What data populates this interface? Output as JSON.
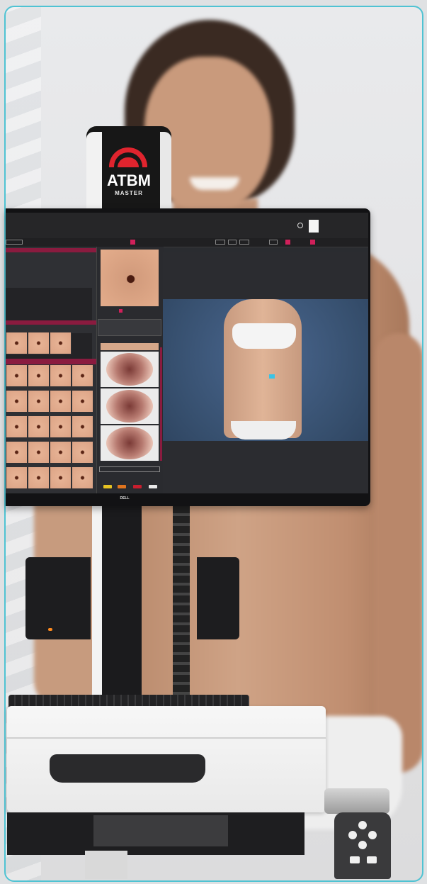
{
  "device": {
    "brand": "ATBM",
    "model": "MASTER",
    "monitor_brand": "DELL"
  },
  "colors": {
    "frame_border": "#4fc3d3",
    "brand_red": "#e0242e",
    "ui_accent": "#d0205a",
    "marker": "#39c3e6"
  },
  "icons": [
    "location-pin-icon",
    "patient-photo-icon",
    "keypad-arrows-icon"
  ]
}
